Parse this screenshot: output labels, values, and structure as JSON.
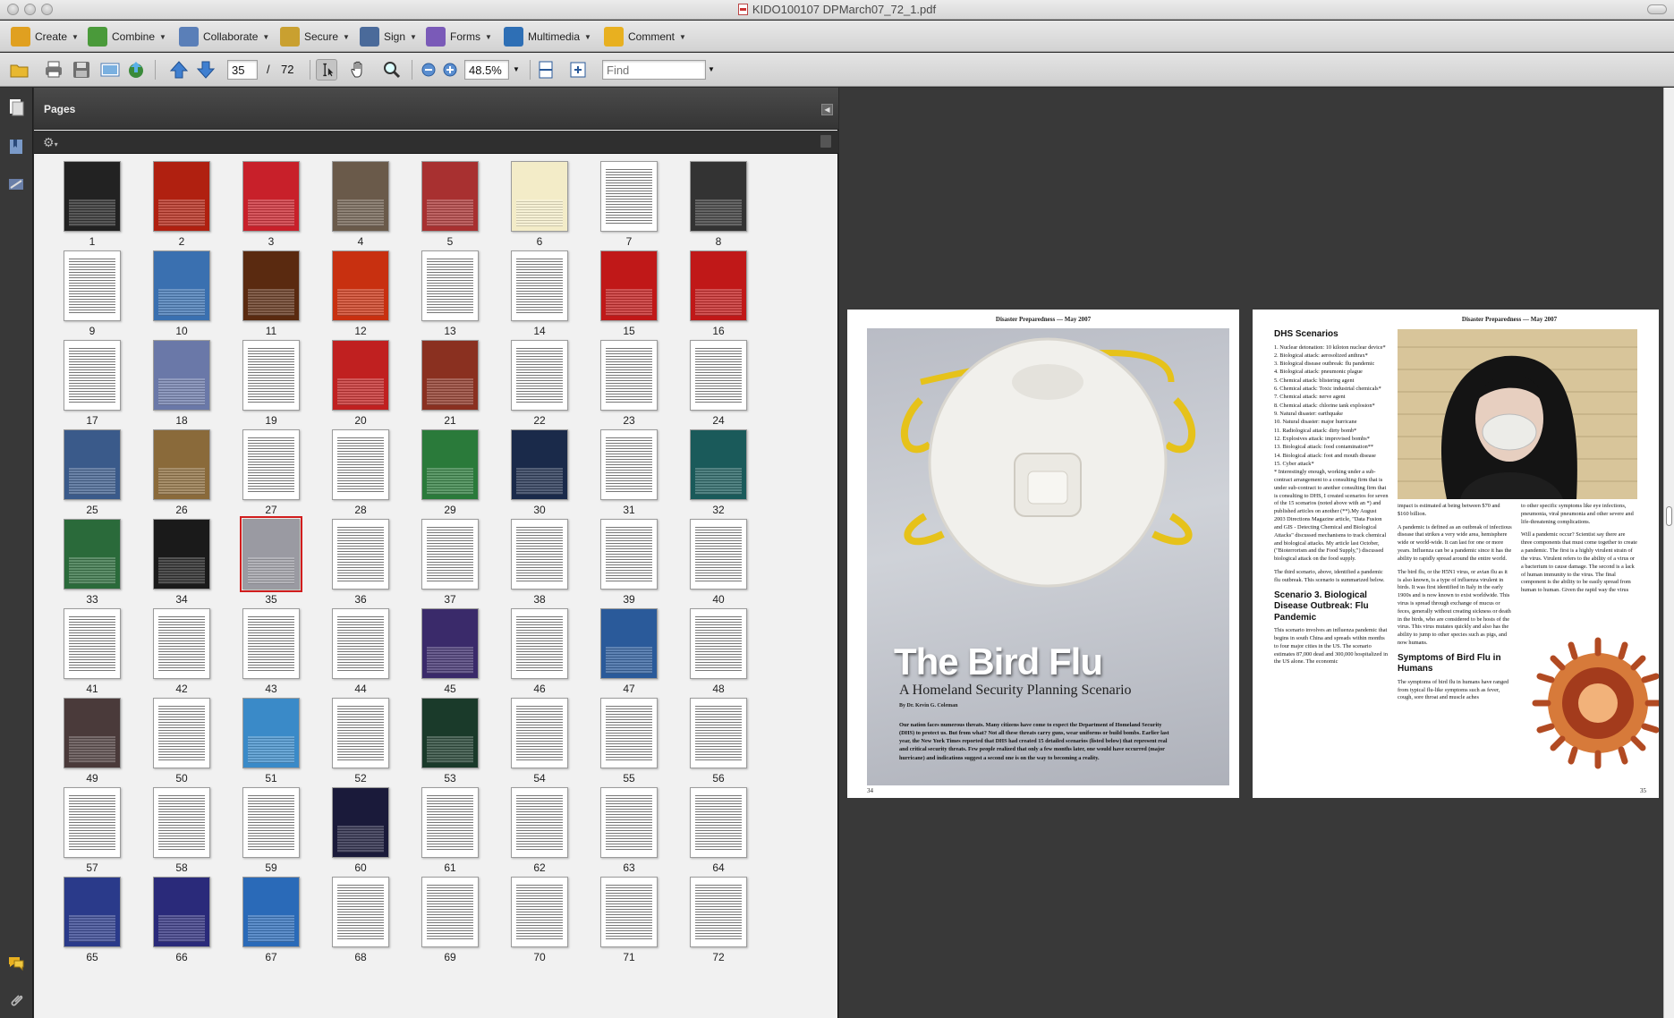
{
  "window": {
    "title": "KIDO100107 DPMarch07_72_1.pdf"
  },
  "tasks": [
    {
      "label": "Create",
      "icon": "create-icon",
      "color": "#e0a020"
    },
    {
      "label": "Combine",
      "icon": "combine-icon",
      "color": "#4a9a3a"
    },
    {
      "label": "Collaborate",
      "icon": "collaborate-icon",
      "color": "#5a7fb8"
    },
    {
      "label": "Secure",
      "icon": "lock-icon",
      "color": "#c9a030"
    },
    {
      "label": "Sign",
      "icon": "pen-icon",
      "color": "#4a6a9a"
    },
    {
      "label": "Forms",
      "icon": "forms-icon",
      "color": "#7a5ab8"
    },
    {
      "label": "Multimedia",
      "icon": "film-icon",
      "color": "#2e6fb5"
    },
    {
      "label": "Comment",
      "icon": "comment-icon",
      "color": "#e8b020"
    }
  ],
  "navbar": {
    "current_page": "35",
    "page_separator": "/",
    "total_pages": "72",
    "zoom": "48.5%",
    "find_placeholder": "Find"
  },
  "panel": {
    "title": "Pages",
    "selected_page": 35
  },
  "thumbnails": [
    {
      "n": "1",
      "c": "#222"
    },
    {
      "n": "2",
      "c": "#b02010"
    },
    {
      "n": "3",
      "c": "#c8202a"
    },
    {
      "n": "4",
      "c": "#6a5a4a"
    },
    {
      "n": "5",
      "c": "#a83030"
    },
    {
      "n": "6",
      "c": "#f3ecc8"
    },
    {
      "n": "7",
      "c": "#fff"
    },
    {
      "n": "8",
      "c": "#333"
    },
    {
      "n": "9",
      "c": "#fff"
    },
    {
      "n": "10",
      "c": "#3a70b0"
    },
    {
      "n": "11",
      "c": "#5a2a10"
    },
    {
      "n": "12",
      "c": "#c83010"
    },
    {
      "n": "13",
      "c": "#fff"
    },
    {
      "n": "14",
      "c": "#fff"
    },
    {
      "n": "15",
      "c": "#c01818"
    },
    {
      "n": "16",
      "c": "#c01818"
    },
    {
      "n": "17",
      "c": "#fff"
    },
    {
      "n": "18",
      "c": "#6a78a8"
    },
    {
      "n": "19",
      "c": "#fff"
    },
    {
      "n": "20",
      "c": "#c02020"
    },
    {
      "n": "21",
      "c": "#8a3020"
    },
    {
      "n": "22",
      "c": "#fff"
    },
    {
      "n": "23",
      "c": "#fff"
    },
    {
      "n": "24",
      "c": "#fff"
    },
    {
      "n": "25",
      "c": "#3a5a8a"
    },
    {
      "n": "26",
      "c": "#8a6a3a"
    },
    {
      "n": "27",
      "c": "#fff"
    },
    {
      "n": "28",
      "c": "#fff"
    },
    {
      "n": "29",
      "c": "#2a7a3a"
    },
    {
      "n": "30",
      "c": "#1a2a4a"
    },
    {
      "n": "31",
      "c": "#fff"
    },
    {
      "n": "32",
      "c": "#1a5a5a"
    },
    {
      "n": "33",
      "c": "#2a6a3a"
    },
    {
      "n": "34",
      "c": "#1a1a1a"
    },
    {
      "n": "35",
      "c": "#9a9aa2"
    },
    {
      "n": "36",
      "c": "#fff"
    },
    {
      "n": "37",
      "c": "#fff"
    },
    {
      "n": "38",
      "c": "#fff"
    },
    {
      "n": "39",
      "c": "#fff"
    },
    {
      "n": "40",
      "c": "#fff"
    },
    {
      "n": "41",
      "c": "#fff"
    },
    {
      "n": "42",
      "c": "#fff"
    },
    {
      "n": "43",
      "c": "#fff"
    },
    {
      "n": "44",
      "c": "#fff"
    },
    {
      "n": "45",
      "c": "#3a2a6a"
    },
    {
      "n": "46",
      "c": "#fff"
    },
    {
      "n": "47",
      "c": "#2a5a9a"
    },
    {
      "n": "48",
      "c": "#fff"
    },
    {
      "n": "49",
      "c": "#4a3a3a"
    },
    {
      "n": "50",
      "c": "#fff"
    },
    {
      "n": "51",
      "c": "#3a8ac8"
    },
    {
      "n": "52",
      "c": "#fff"
    },
    {
      "n": "53",
      "c": "#1a3a2a"
    },
    {
      "n": "54",
      "c": "#fff"
    },
    {
      "n": "55",
      "c": "#fff"
    },
    {
      "n": "56",
      "c": "#fff"
    },
    {
      "n": "57",
      "c": "#fff"
    },
    {
      "n": "58",
      "c": "#fff"
    },
    {
      "n": "59",
      "c": "#fff"
    },
    {
      "n": "60",
      "c": "#1a1a3a"
    },
    {
      "n": "61",
      "c": "#fff"
    },
    {
      "n": "62",
      "c": "#fff"
    },
    {
      "n": "63",
      "c": "#fff"
    },
    {
      "n": "64",
      "c": "#fff"
    },
    {
      "n": "65",
      "c": "#2a3a8a"
    },
    {
      "n": "66",
      "c": "#2a2a7a"
    },
    {
      "n": "67",
      "c": "#2a6ab8"
    },
    {
      "n": "68",
      "c": "#fff"
    },
    {
      "n": "69",
      "c": "#fff"
    },
    {
      "n": "70",
      "c": "#fff"
    },
    {
      "n": "71",
      "c": "#fff"
    },
    {
      "n": "72",
      "c": "#fff"
    }
  ],
  "spread": {
    "left": {
      "running_head": "Disaster Preparedness — May 2007",
      "title": "The Bird Flu",
      "subtitle": "A Homeland Security Planning Scenario",
      "byline": "By Dr. Kevin G. Coleman",
      "intro": "Our nation faces numerous threats. Many citizens have come to expect the Department of Homeland Security (DHS) to protect us. But from what? Not all these threats carry guns, wear uniforms or build bombs. Earlier last year, the New York Times reported that DHS had created 15 detailed scenarios (listed below) that represent real and critical security threats. Few people realized that only a few months later, one would have occurred (major hurricane) and indications suggest a second one is on the way to becoming a reality.",
      "page_number": "34"
    },
    "right": {
      "running_head": "Disaster Preparedness — May 2007",
      "heading": "DHS Scenarios",
      "scenarios": [
        "1.  Nuclear detonation: 10 kiloton nuclear device*",
        "2.  Biological attack: aerosolized anthrax*",
        "3.  Biological disease outbreak: flu pandemic",
        "4.  Biological attack: pneumonic plague",
        "5.  Chemical attack: blistering agent",
        "6.  Chemical attack: Toxic industrial chemicals*",
        "7.  Chemical attack: nerve agent",
        "8.  Chemical attack: chlorine tank explosion*",
        "9.  Natural disaster: earthquake",
        "10. Natural disaster: major hurricane",
        "11. Radiological attack: dirty bomb*",
        "12. Explosives attack: improvised bombs*",
        "13. Biological attack: food contamination**",
        "14. Biological attack: foot and mouth disease",
        "15. Cyber attack*"
      ],
      "para1": "* Interestingly enough, working under a sub-contract arrangement to a consulting firm that is under sub-contract to another consulting firm that is consulting to DHS, I created scenarios for seven of the 15 scenarios (noted above with an *) and published articles on another (**).My August 2003 Directions Magazine article, \"Data Fusion and GIS - Detecting Chemical and Biological Attacks\" discussed mechanisms to track chemical and biological attacks. My article last October, (\"Bioterrorism and the Food Supply,\") discussed biological attack on the food supply.",
      "para2": "The third scenario, above, identified a pandemic flu outbreak. This scenario is summarized below.",
      "scenario3_heading": "Scenario 3. Biological Disease Outbreak: Flu Pandemic",
      "para3": "This scenario involves an influenza pandemic that begins in south China and spreads within months to four major cities in the US. The scenario estimates 87,000 dead and 300,000 hospitalized in the US alone. The economic",
      "col3_p1": "impact is estimated at being between $70 and $160 billion.",
      "col3_p2": "A pandemic is defined as an outbreak of infectious disease that strikes a very wide area, hemisphere wide or world-wide. It can last for one or more years. Influenza can be a pandemic since it has the ability to rapidly spread around the entire world.",
      "col3_p3": "The bird flu, or the H5N1 virus, or avian flu as it is also known, is a type of influenza virulent in birds. It was first identified in Italy in the early 1900s and is now known to exist worldwide. This virus is spread through exchange of mucus or feces, generally without creating sickness or death in the birds, who are considered to be hosts of the virus. This virus mutates quickly and also has the ability to jump to other species such as pigs, and now humans.",
      "symptoms_heading": "Symptoms of Bird Flu in Humans",
      "col3_p4": "The symptoms of bird flu in humans have ranged from typical flu-like symptoms such as fever, cough, sore throat and muscle aches",
      "col4_p1": "to other specific symptoms like eye infections, pneumonia, viral pneumonia and other severe and life-threatening complications.",
      "col4_p2": "Will a pandemic occur? Scientist say there are three components that must come together to create a pandemic. The first is a highly virulent strain of the virus. Virulent refers to the ability of a virus or a bacterium to cause damage. The second is a lack of human immunity to the virus. The final component is the ability to be easily spread from human to human. Given the rapid way the virus",
      "page_number": "35"
    }
  }
}
